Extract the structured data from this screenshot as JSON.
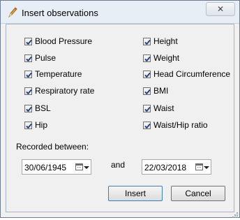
{
  "window": {
    "title": "Insert observations",
    "close_glyph": "✕"
  },
  "checkboxes": {
    "left": [
      {
        "label": "Blood Pressure",
        "checked": true
      },
      {
        "label": "Pulse",
        "checked": true
      },
      {
        "label": "Temperature",
        "checked": true
      },
      {
        "label": "Respiratory rate",
        "checked": true
      },
      {
        "label": "BSL",
        "checked": true
      },
      {
        "label": "Hip",
        "checked": true
      }
    ],
    "right": [
      {
        "label": "Height",
        "checked": true
      },
      {
        "label": "Weight",
        "checked": true
      },
      {
        "label": "Head Circumference",
        "checked": true
      },
      {
        "label": "BMI",
        "checked": true
      },
      {
        "label": "Waist",
        "checked": true
      },
      {
        "label": "Waist/Hip ratio",
        "checked": true
      }
    ]
  },
  "recorded": {
    "label": "Recorded between:",
    "from_date": "30/06/1945",
    "and_label": "and",
    "to_date": "22/03/2018"
  },
  "buttons": {
    "insert": "Insert",
    "cancel": "Cancel"
  },
  "icons": {
    "app": "pencil-icon",
    "close": "close-icon",
    "calendar": "calendar-icon",
    "dropdown": "chevron-down-icon"
  },
  "colors": {
    "check": "#1f3e7a",
    "title_bg": "#e8eef6",
    "dialog_bg": "#f0f0f0"
  }
}
